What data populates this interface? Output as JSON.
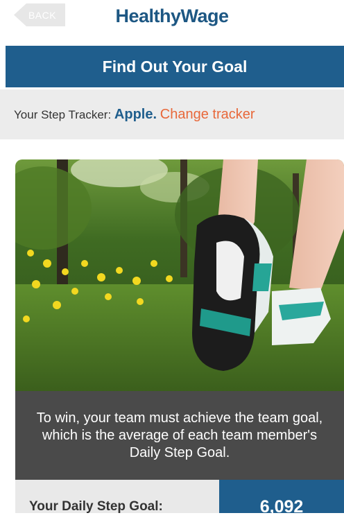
{
  "header": {
    "back_label": "BACK",
    "logo_text": "HealthyWage"
  },
  "title": "Find Out Your Goal",
  "tracker": {
    "prefix": "Your Step Tracker:",
    "name": "Apple.",
    "change_label": "Change tracker"
  },
  "info_text": "To win, your team must achieve the team goal, which is the average of each team member's Daily Step Goal.",
  "goal": {
    "label": "Your Daily Step Goal:",
    "value": "6,092"
  },
  "colors": {
    "brand_blue": "#1f5e8d",
    "link_orange": "#e8683a",
    "panel_dark": "#4a4a4a",
    "panel_light": "#ececec"
  }
}
